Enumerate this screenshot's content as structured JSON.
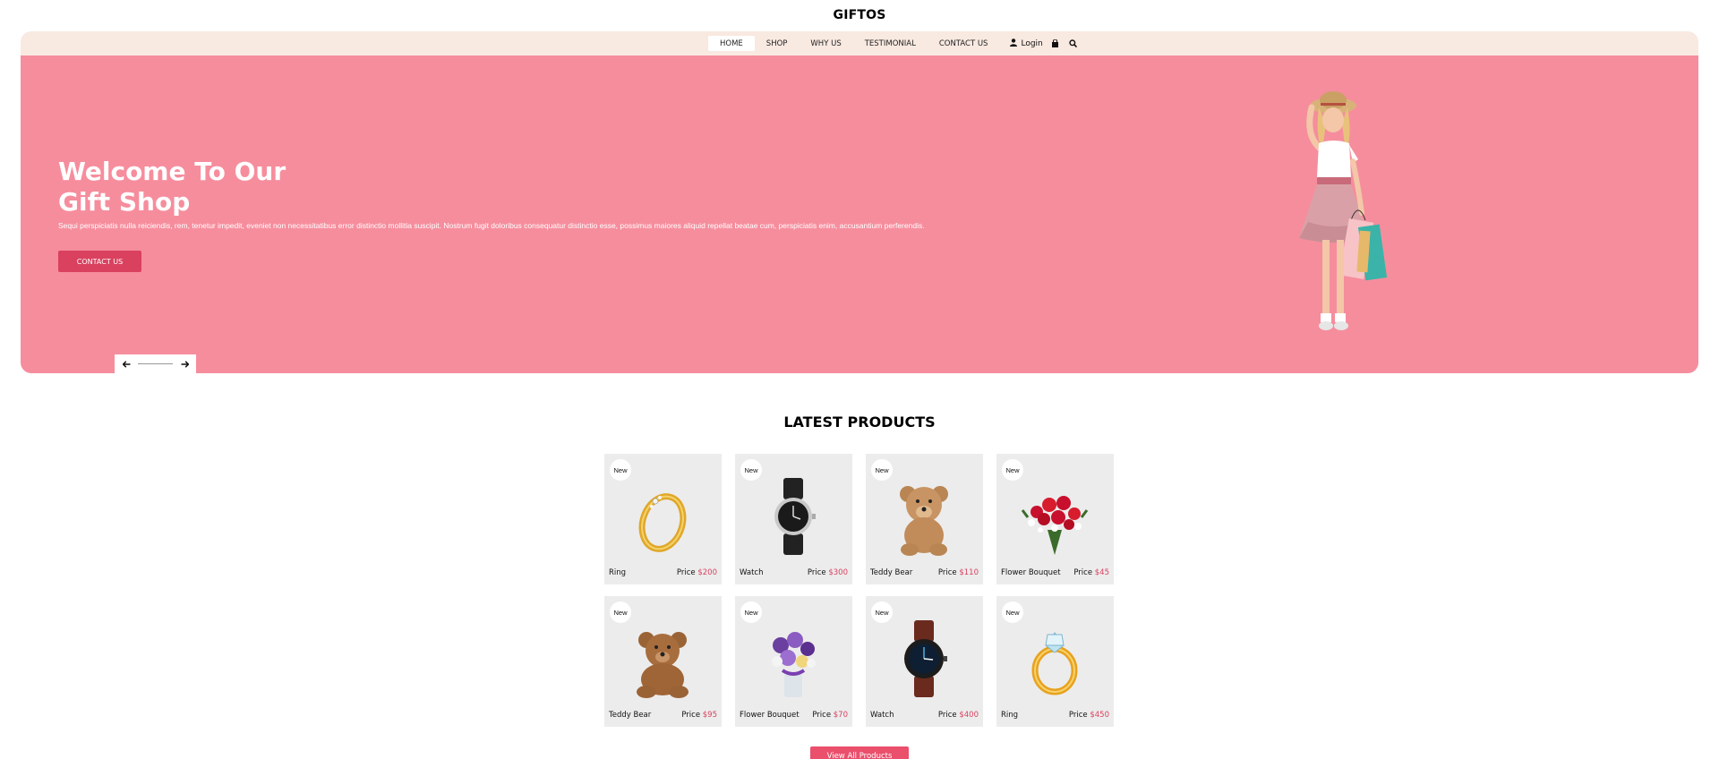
{
  "brand": "GIFTOS",
  "nav": {
    "items": [
      "HOME",
      "SHOP",
      "WHY US",
      "TESTIMONIAL",
      "CONTACT US"
    ],
    "login": "Login"
  },
  "hero": {
    "title_line1": "Welcome To Our",
    "title_line2": "Gift Shop",
    "text": "Sequi perspiciatis nulla reiciendis, rem, tenetur impedit, eveniet non necessitatibus error distinctio mollitia suscipit. Nostrum fugit doloribus consequatur distinctio esse, possimus maiores aliquid repellat beatae cum, perspiciatis enim, accusantium perferendis.",
    "button": "CONTACT US"
  },
  "section_title": "LATEST PRODUCTS",
  "products": [
    {
      "badge": "New",
      "name": "Ring",
      "price_label": "Price",
      "price": "$200",
      "icon": "ring"
    },
    {
      "badge": "New",
      "name": "Watch",
      "price_label": "Price",
      "price": "$300",
      "icon": "watch"
    },
    {
      "badge": "New",
      "name": "Teddy Bear",
      "price_label": "Price",
      "price": "$110",
      "icon": "teddy"
    },
    {
      "badge": "New",
      "name": "Flower Bouquet",
      "price_label": "Price",
      "price": "$45",
      "icon": "bouquet"
    },
    {
      "badge": "New",
      "name": "Teddy Bear",
      "price_label": "Price",
      "price": "$95",
      "icon": "teddy"
    },
    {
      "badge": "New",
      "name": "Flower Bouquet",
      "price_label": "Price",
      "price": "$70",
      "icon": "bouquet"
    },
    {
      "badge": "New",
      "name": "Watch",
      "price_label": "Price",
      "price": "$400",
      "icon": "watch"
    },
    {
      "badge": "New",
      "name": "Ring",
      "price_label": "Price",
      "price": "$450",
      "icon": "ring"
    }
  ],
  "view_all": "View All Products",
  "colors": {
    "hero_bg": "#f68d9d",
    "accent": "#d9415f",
    "nav_bg": "#f8e9e1"
  }
}
